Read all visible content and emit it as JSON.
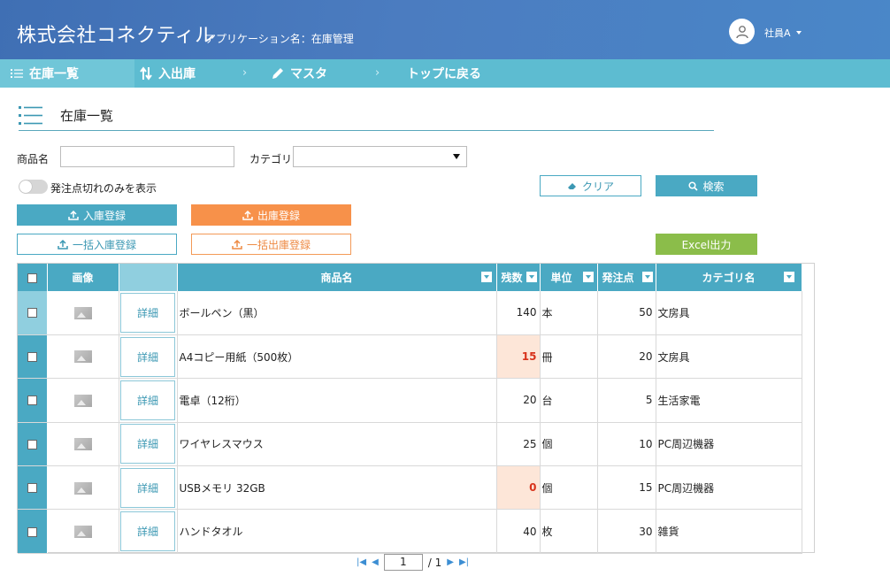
{
  "header": {
    "company": "株式会社コネクティル",
    "app_name": "アプリケーション名：在庫管理",
    "user": "社員A"
  },
  "nav": {
    "items": [
      {
        "label": "在庫一覧",
        "icon": "list-icon"
      },
      {
        "label": "入出庫",
        "icon": "sort-arrows-icon"
      },
      {
        "label": "マスタ",
        "icon": "pencil-icon"
      },
      {
        "label": "トップに戻る",
        "icon": ""
      }
    ],
    "separator": "›"
  },
  "page": {
    "title": "在庫一覧"
  },
  "search": {
    "product_label": "商品名",
    "product_value": "",
    "category_label": "カテゴリ",
    "category_value": "",
    "toggle_label": "発注点切れのみを表示",
    "toggle_on": false
  },
  "buttons": {
    "clear": "クリア",
    "search": "検索",
    "stock_in": "入庫登録",
    "stock_out": "出庫登録",
    "bulk_in": "一括入庫登録",
    "bulk_out": "一括出庫登録",
    "excel": "Excel出力"
  },
  "colors": {
    "header": "#4a7dc0",
    "nav": "#5dbcd1",
    "teal": "#4aa9c3",
    "orange": "#f7914a",
    "green": "#8bbd4a",
    "warn_bg": "#fde6d8",
    "warn_text": "#d8331c"
  },
  "table": {
    "columns": [
      "画像",
      "商品名",
      "残数",
      "単位",
      "発注点",
      "カテゴリ名"
    ],
    "detail_label": "詳細",
    "rows": [
      {
        "name": "ボールペン（黒）",
        "stock": "140",
        "unit": "本",
        "reorder": "50",
        "category": "文房具",
        "warn": false
      },
      {
        "name": "A4コピー用紙（500枚）",
        "stock": "15",
        "unit": "冊",
        "reorder": "20",
        "category": "文房具",
        "warn": true
      },
      {
        "name": "電卓（12桁）",
        "stock": "20",
        "unit": "台",
        "reorder": "5",
        "category": "生活家電",
        "warn": false
      },
      {
        "name": "ワイヤレスマウス",
        "stock": "25",
        "unit": "個",
        "reorder": "10",
        "category": "PC周辺機器",
        "warn": false
      },
      {
        "name": "USBメモリ 32GB",
        "stock": "0",
        "unit": "個",
        "reorder": "15",
        "category": "PC周辺機器",
        "warn": true
      },
      {
        "name": "ハンドタオル",
        "stock": "40",
        "unit": "枚",
        "reorder": "30",
        "category": "雑貨",
        "warn": false
      }
    ]
  },
  "pager": {
    "current": "1",
    "total": "/ 1"
  }
}
